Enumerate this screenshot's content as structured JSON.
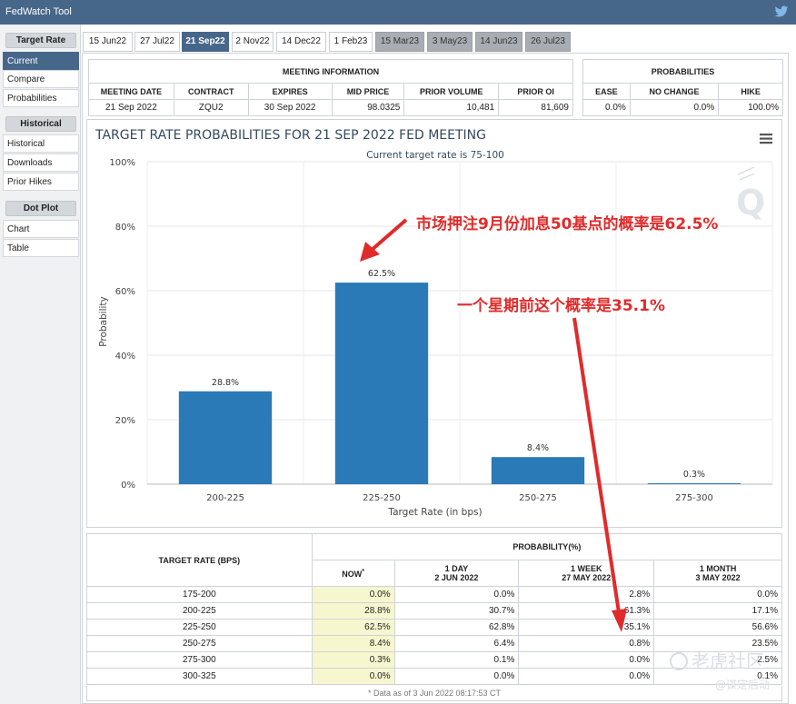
{
  "app_title": "FedWatch Tool",
  "sidebar": {
    "groups": [
      {
        "header": "Target Rate",
        "items": [
          {
            "label": "Current",
            "active": true
          },
          {
            "label": "Compare"
          },
          {
            "label": "Probabilities"
          }
        ]
      },
      {
        "header": "Historical",
        "items": [
          {
            "label": "Historical"
          },
          {
            "label": "Downloads"
          },
          {
            "label": "Prior Hikes"
          }
        ]
      },
      {
        "header": "Dot Plot",
        "items": [
          {
            "label": "Chart"
          },
          {
            "label": "Table"
          }
        ]
      }
    ]
  },
  "tabs": [
    {
      "label": "15 Jun22"
    },
    {
      "label": "27 Jul22"
    },
    {
      "label": "21 Sep22",
      "active": true
    },
    {
      "label": "2 Nov22"
    },
    {
      "label": "14 Dec22"
    },
    {
      "label": "1 Feb23"
    },
    {
      "label": "15 Mar23",
      "dim": true
    },
    {
      "label": "3 May23",
      "dim": true
    },
    {
      "label": "14 Jun23",
      "dim": true
    },
    {
      "label": "26 Jul23",
      "dim": true
    }
  ],
  "meeting_info": {
    "title": "MEETING INFORMATION",
    "headers": [
      "MEETING DATE",
      "CONTRACT",
      "EXPIRES",
      "MID PRICE",
      "PRIOR VOLUME",
      "PRIOR OI"
    ],
    "row": [
      "21 Sep 2022",
      "ZQU2",
      "30 Sep 2022",
      "98.0325",
      "10,481",
      "81,609"
    ]
  },
  "probabilities": {
    "title": "PROBABILITIES",
    "headers": [
      "EASE",
      "NO CHANGE",
      "HIKE"
    ],
    "row": [
      "0.0%",
      "0.0%",
      "100.0%"
    ]
  },
  "chart": {
    "title": "TARGET RATE PROBABILITIES FOR 21 SEP 2022 FED MEETING",
    "subtitle": "Current target rate is 75-100",
    "menu_icon": "hamburger-menu-icon",
    "watermark_logo": "Q"
  },
  "chart_data": {
    "type": "bar",
    "categories": [
      "200-225",
      "225-250",
      "250-275",
      "275-300"
    ],
    "values": [
      28.8,
      62.5,
      8.4,
      0.3
    ],
    "data_labels": [
      "28.8%",
      "62.5%",
      "8.4%",
      "0.3%"
    ],
    "title": "TARGET RATE PROBABILITIES FOR 21 SEP 2022 FED MEETING",
    "subtitle": "Current target rate is 75-100",
    "xlabel": "Target Rate (in bps)",
    "ylabel": "Probability",
    "ylim": [
      0,
      100
    ],
    "yticks": [
      "0%",
      "20%",
      "40%",
      "60%",
      "80%",
      "100%"
    ],
    "grid": true,
    "bar_color": "#2a7ab8"
  },
  "annotations": {
    "a1": "市场押注9月份加息50基点的概率是62.5%",
    "a2": "一个星期前这个概率是35.1%"
  },
  "rate_table": {
    "col_header": "TARGET RATE (BPS)",
    "prob_header": "PROBABILITY(%)",
    "sub_headers": [
      {
        "line1": "NOW",
        "line2": ""
      },
      {
        "line1": "1 DAY",
        "line2": "2 JUN 2022"
      },
      {
        "line1": "1 WEEK",
        "line2": "27 MAY 2022"
      },
      {
        "line1": "1 MONTH",
        "line2": "3 MAY 2022"
      }
    ],
    "now_marker": "*",
    "rows": [
      [
        "175-200",
        "0.0%",
        "0.0%",
        "2.8%",
        "0.0%"
      ],
      [
        "200-225",
        "28.8%",
        "30.7%",
        "61.3%",
        "17.1%"
      ],
      [
        "225-250",
        "62.5%",
        "62.8%",
        "35.1%",
        "56.6%"
      ],
      [
        "250-275",
        "8.4%",
        "6.4%",
        "0.8%",
        "23.5%"
      ],
      [
        "275-300",
        "0.3%",
        "0.1%",
        "0.0%",
        "2.5%"
      ],
      [
        "300-325",
        "0.0%",
        "0.0%",
        "0.0%",
        "0.1%"
      ]
    ],
    "footnote": "* Data as of 3 Jun 2022 08:17:53 CT"
  },
  "watermark": {
    "line1": "老虎社区",
    "line2": "@谋定后动"
  },
  "colors": {
    "nav": "#47678a",
    "bar": "#2a7ab8",
    "annotation": "#e02b2b",
    "now_cell": "#f7f7cf"
  }
}
